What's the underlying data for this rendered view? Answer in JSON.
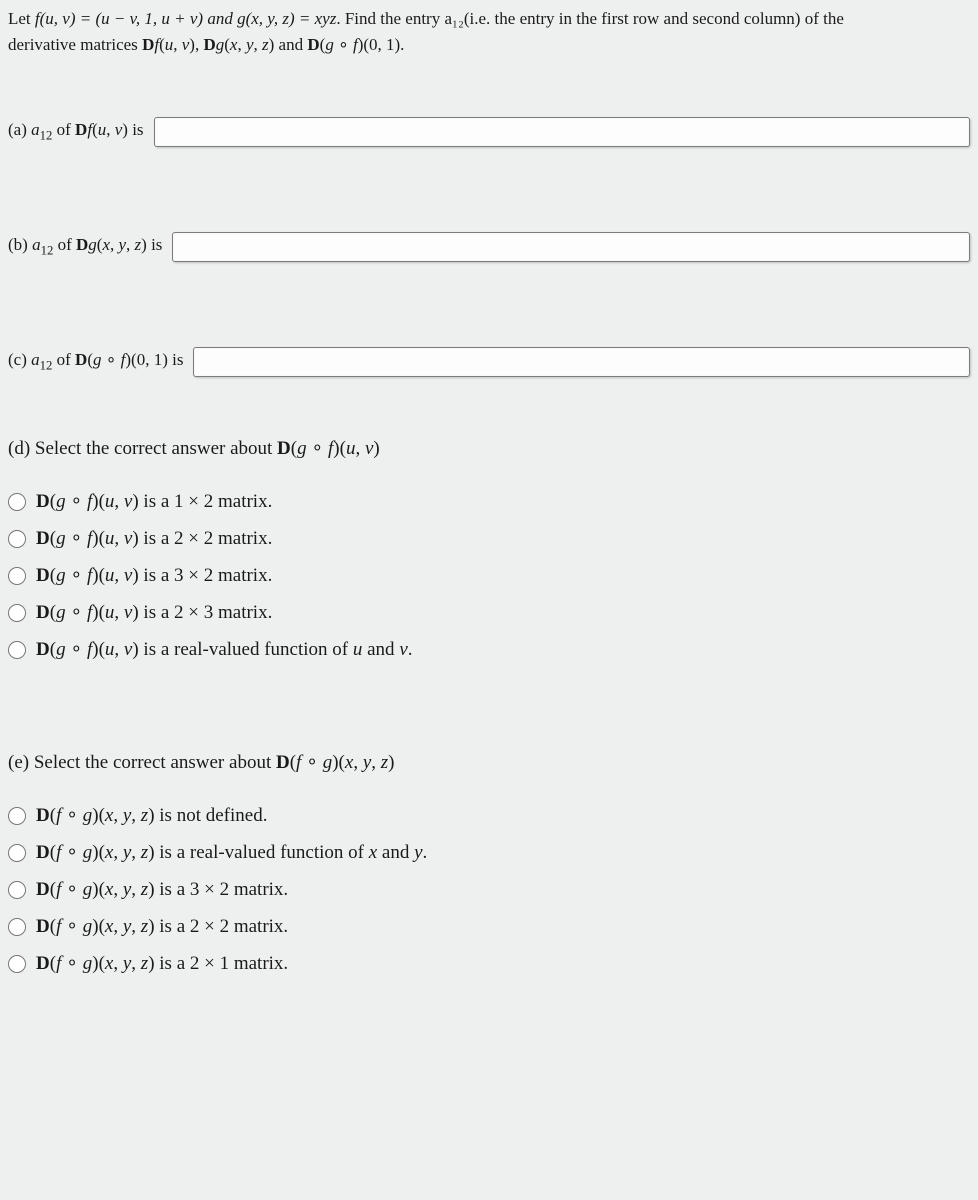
{
  "problem": {
    "line1_pre": "Let ",
    "line1_math": "f(u, v) = (u − v, 1, u + v) and g(x, y, z) = xyz",
    "line1_post": ". Find the entry a₁₂(i.e. the entry in the first row and second column) of the",
    "line2": "derivative matrices Df(u, v), Dg(x, y, z) and D(g ∘ f)(0, 1)."
  },
  "parts": {
    "a_label": "(a) a₁₂ of Df(u, v) is",
    "b_label": "(b) a₁₂ of Dg(x, y, z) is",
    "c_label": "(c) a₁₂ of D(g ∘ f)(0, 1) is"
  },
  "d": {
    "prompt": "(d) Select the correct answer about D(g ∘ f)(u, v)",
    "opts": [
      "D(g ∘ f)(u, v) is a 1 × 2 matrix.",
      "D(g ∘ f)(u, v) is a 2 × 2 matrix.",
      "D(g ∘ f)(u, v) is a 3 × 2 matrix.",
      "D(g ∘ f)(u, v) is a 2 × 3 matrix.",
      "D(g ∘ f)(u, v) is a real-valued function of u and v."
    ]
  },
  "e": {
    "prompt": "(e) Select the correct answer about D(f ∘ g)(x, y, z)",
    "opts": [
      "D(f ∘ g)(x, y, z) is not defined.",
      "D(f ∘ g)(x, y, z) is a real-valued function of x and y.",
      "D(f ∘ g)(x, y, z) is a 3 × 2 matrix.",
      "D(f ∘ g)(x, y, z) is a 2 × 2 matrix.",
      "D(f ∘ g)(x, y, z) is a 2 × 1 matrix."
    ]
  }
}
